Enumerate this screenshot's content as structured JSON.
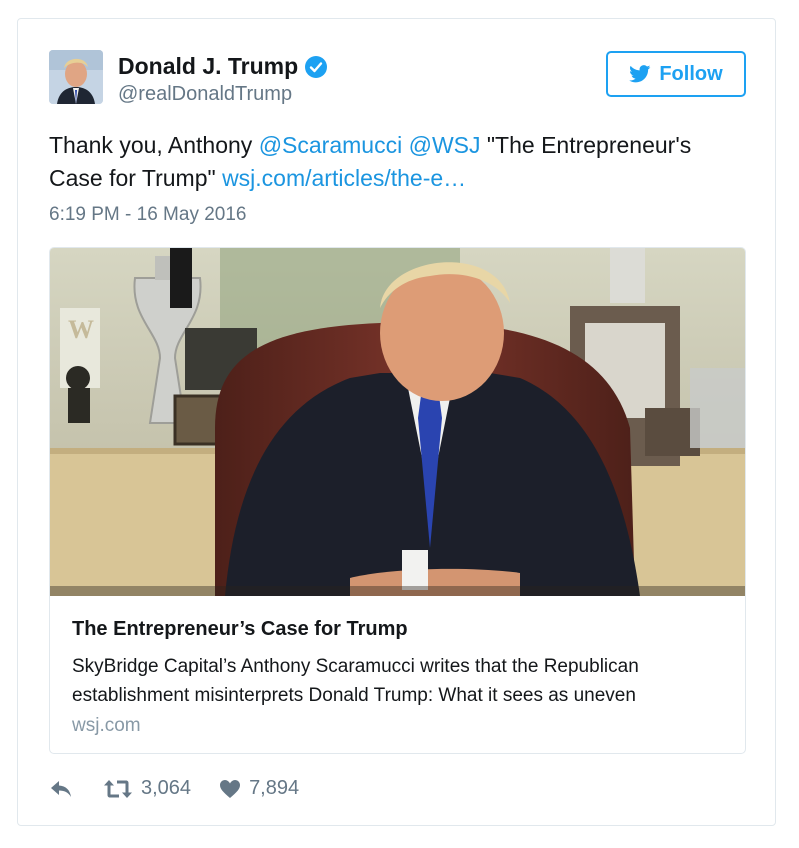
{
  "author": {
    "name": "Donald J. Trump",
    "handle": "@realDonaldTrump"
  },
  "follow_label": "Follow",
  "tweet": {
    "text_prefix": "Thank you, Anthony ",
    "mention1": "@Scaramucci",
    "space": " ",
    "mention2": "@WSJ",
    "text_middle": " \"The Entrepreneur's Case for Trump\" ",
    "link": "wsj.com/articles/the-e…",
    "timestamp": "6:19 PM - 16 May 2016"
  },
  "card": {
    "title": "The Entrepreneur’s Case for Trump",
    "description": "SkyBridge Capital’s Anthony Scaramucci writes that the Republican establishment misinterprets Donald Trump: What it sees as uneven",
    "domain": "wsj.com"
  },
  "actions": {
    "retweets": "3,064",
    "likes": "7,894"
  },
  "icons": [
    "verified-badge-icon",
    "twitter-bird-icon",
    "reply-icon",
    "retweet-icon",
    "heart-icon"
  ],
  "colors": {
    "accent": "#1da1f2",
    "link": "#1b95e0",
    "secondary_text": "#657786",
    "border": "#e1e8ed"
  }
}
